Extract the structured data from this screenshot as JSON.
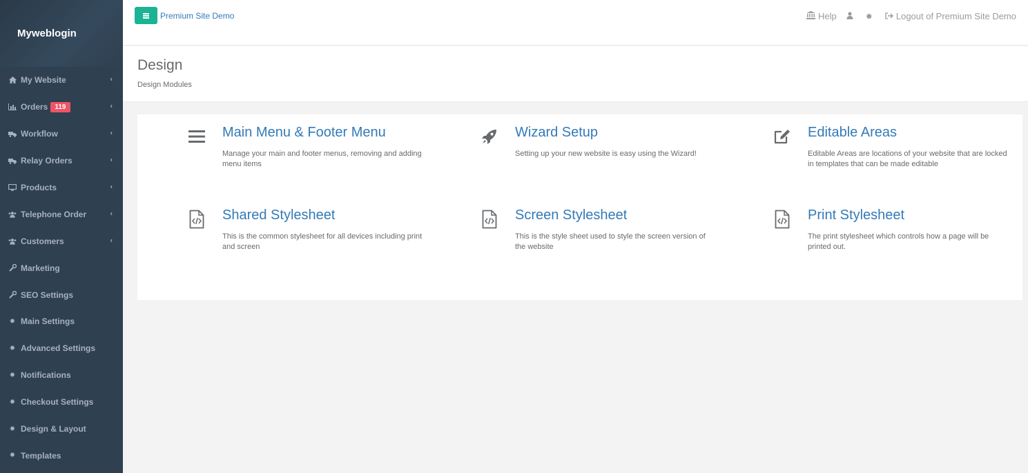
{
  "brand": "Myweblogin",
  "sidebar": {
    "items": [
      {
        "label": "My Website",
        "icon": "home-icon",
        "chevron": true
      },
      {
        "label": "Orders",
        "icon": "bar-chart-icon",
        "chevron": true,
        "badge": "119"
      },
      {
        "label": "Workflow",
        "icon": "truck-icon",
        "chevron": true
      },
      {
        "label": "Relay Orders",
        "icon": "truck-icon",
        "chevron": true
      },
      {
        "label": "Products",
        "icon": "desktop-icon",
        "chevron": true
      },
      {
        "label": "Telephone Order",
        "icon": "users-icon",
        "chevron": true
      },
      {
        "label": "Customers",
        "icon": "users-icon",
        "chevron": true
      },
      {
        "label": "Marketing",
        "icon": "wrench-icon",
        "chevron": false
      },
      {
        "label": "SEO Settings",
        "icon": "wrench-icon",
        "chevron": false
      },
      {
        "label": "Main Settings",
        "icon": "gear-icon",
        "chevron": false
      },
      {
        "label": "Advanced Settings",
        "icon": "gear-icon",
        "chevron": false
      },
      {
        "label": "Notifications",
        "icon": "gear-icon",
        "chevron": false
      },
      {
        "label": "Checkout Settings",
        "icon": "gear-icon",
        "chevron": false
      },
      {
        "label": "Design & Layout",
        "icon": "gear-icon",
        "chevron": false
      },
      {
        "label": "Templates",
        "icon": "gear-icon",
        "chevron": false
      }
    ]
  },
  "topbar": {
    "site_name": "Premium Site Demo",
    "help": "Help",
    "logout": "Logout of Premium Site Demo"
  },
  "heading": {
    "title": "Design",
    "breadcrumb": "Design Modules"
  },
  "modules": [
    {
      "title": "Main Menu & Footer Menu",
      "desc": "Manage your main and footer menus, removing and adding menu items",
      "icon": "bars-icon"
    },
    {
      "title": "Wizard Setup",
      "desc": "Setting up your new website is easy using the Wizard!",
      "icon": "rocket-icon"
    },
    {
      "title": "Editable Areas",
      "desc": "Editable Areas are locations of your website that are locked in templates that can be made editable",
      "icon": "edit-icon"
    },
    {
      "title": "Shared Stylesheet",
      "desc": "This is the common stylesheet for all devices including print and screen",
      "icon": "code-file-icon"
    },
    {
      "title": "Screen Stylesheet",
      "desc": "This is the style sheet used to style the screen version of the website",
      "icon": "code-file-icon"
    },
    {
      "title": "Print Stylesheet",
      "desc": "The print stylesheet which controls how a page will be printed out.",
      "icon": "code-file-icon"
    }
  ]
}
